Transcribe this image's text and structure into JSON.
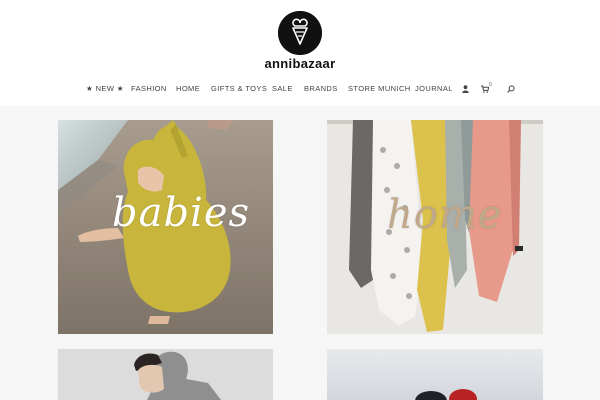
{
  "brand": {
    "name": "annibazaar",
    "logo_icon": "ice-cream-cone-monogram"
  },
  "nav": {
    "items": [
      "★ NEW ★",
      "FASHION",
      "HOME",
      "GIFTS & TOYS",
      "SALE",
      "BRANDS",
      "STORE MUNICH",
      "JOURNAL"
    ],
    "icons": [
      "user-icon",
      "cart-icon",
      "search-icon"
    ],
    "cart_count": "0"
  },
  "tiles": [
    {
      "label": "babies",
      "photo": "toddler in yellow hooded towel on beach"
    },
    {
      "label": "home",
      "photo": "hanging muslin cloths"
    },
    {
      "label": "",
      "photo": "child in grey hoodie"
    },
    {
      "label": "",
      "photo": "sky with red cap"
    }
  ],
  "colors": {
    "background": "#f6f6f6",
    "header": "#ffffff",
    "logo": "#111111",
    "nav_text": "#444444"
  }
}
